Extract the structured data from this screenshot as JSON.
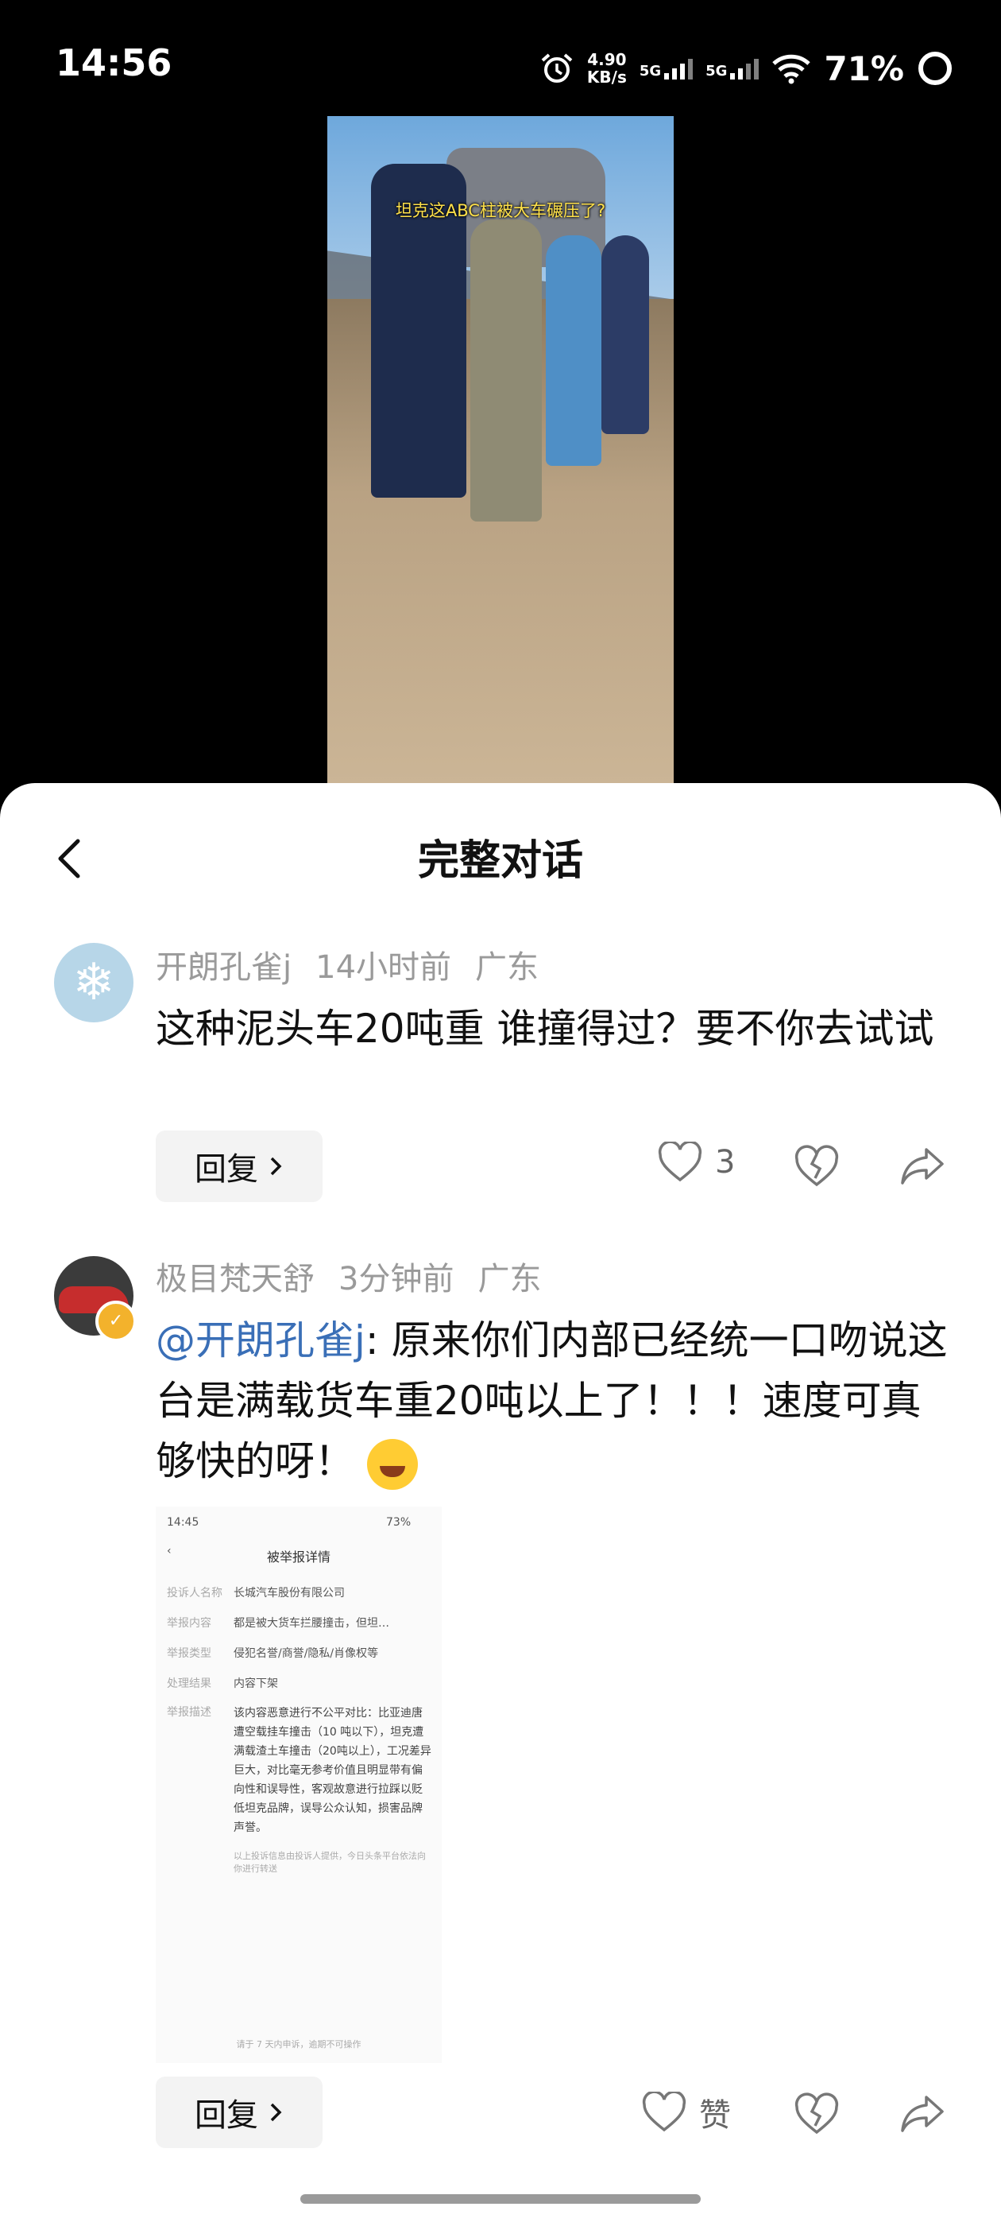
{
  "status_bar": {
    "time": "14:56",
    "net_speed_value": "4.90",
    "net_speed_unit": "KB/s",
    "net1": "5G",
    "net2": "5G",
    "battery": "71%"
  },
  "video": {
    "caption": "坦克这ABC柱被大车碾压了?"
  },
  "sheet": {
    "title": "完整对话"
  },
  "comments": [
    {
      "username": "开朗孔雀j",
      "time": "14小时前",
      "location": "广东",
      "text": "这种泥头车20吨重 谁撞得过？要不你去试试",
      "reply_label": "回复",
      "like_count": "3"
    },
    {
      "username": "极目梵天舒",
      "time": "3分钟前",
      "location": "广东",
      "mention": "@开朗孔雀j",
      "text": ": 原来你们内部已经统一口吻说这台是满载货车重20吨以上了！！！速度可真够快的呀！",
      "reply_label": "回复",
      "like_label": "赞"
    }
  ],
  "screenshot": {
    "time": "14:45",
    "status_right": "73%",
    "title": "被举报详情",
    "rows": [
      {
        "label": "投诉人名称",
        "value": "长城汽车股份有限公司"
      },
      {
        "label": "举报内容",
        "value": "都是被大货车拦腰撞击，但坦…"
      },
      {
        "label": "举报类型",
        "value": "侵犯名誉/商誉/隐私/肖像权等"
      },
      {
        "label": "处理结果",
        "value": "内容下架"
      },
      {
        "label": "举报描述",
        "value": ""
      }
    ],
    "description": "该内容恶意进行不公平对比：比亚迪唐遭空载挂车撞击（10 吨以下），坦克遭满载渣土车撞击（20吨以上），工况差异巨大，对比毫无参考价值且明显带有偏向性和误导性，客观故意进行拉踩以贬低坦克品牌，误导公众认知，损害品牌声誉。",
    "footnote": "以上投诉信息由投诉人提供，今日头条平台依法向你进行转送",
    "bottom": "请于 7 天内申诉，逾期不可操作"
  }
}
